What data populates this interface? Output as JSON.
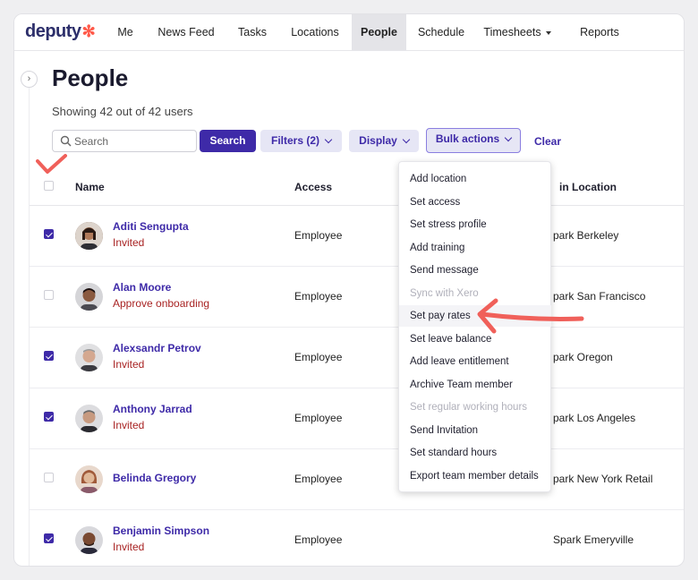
{
  "nav": {
    "logo_text": "deputy",
    "items": [
      {
        "label": "Me"
      },
      {
        "label": "News Feed"
      },
      {
        "label": "Tasks"
      },
      {
        "label": "Locations"
      },
      {
        "label": "People"
      },
      {
        "label": "Schedule"
      },
      {
        "label": "Timesheets"
      },
      {
        "label": "Reports"
      }
    ],
    "active": "People"
  },
  "page": {
    "title": "People",
    "subtitle": "Showing 42 out of 42 users"
  },
  "toolbar": {
    "search_placeholder": "Search",
    "search_button": "Search",
    "filters_label": "Filters (2)",
    "display_label": "Display",
    "bulk_label": "Bulk actions",
    "clear_label": "Clear"
  },
  "table": {
    "headers": {
      "name": "Name",
      "access": "Access",
      "location": "in Location"
    },
    "rows": [
      {
        "name": "Aditi Sengupta",
        "status": "Invited",
        "access": "Employee",
        "location": "park Berkeley",
        "checked": true
      },
      {
        "name": "Alan Moore",
        "status": "Approve onboarding",
        "access": "Employee",
        "location": "park San Francisco",
        "checked": false
      },
      {
        "name": "Alexsandr Petrov",
        "status": "Invited",
        "access": "Employee",
        "location": "park Oregon",
        "checked": true
      },
      {
        "name": "Anthony Jarrad",
        "status": "Invited",
        "access": "Employee",
        "location": "park Los Angeles",
        "checked": true
      },
      {
        "name": "Belinda Gregory",
        "status": "",
        "access": "Employee",
        "location": "park New York Retail",
        "checked": false
      },
      {
        "name": "Benjamin Simpson",
        "status": "Invited",
        "access": "Employee",
        "location": "Spark Emeryville",
        "checked": true
      }
    ]
  },
  "bulk_menu": {
    "items": [
      {
        "label": "Add location",
        "disabled": false
      },
      {
        "label": "Set access",
        "disabled": false
      },
      {
        "label": "Set stress profile",
        "disabled": false
      },
      {
        "label": "Add training",
        "disabled": false
      },
      {
        "label": "Send message",
        "disabled": false
      },
      {
        "label": "Sync with Xero",
        "disabled": true
      },
      {
        "label": "Set pay rates",
        "disabled": false,
        "highlighted": true
      },
      {
        "label": "Set leave balance",
        "disabled": false
      },
      {
        "label": "Add leave entitlement",
        "disabled": false
      },
      {
        "label": "Archive Team member",
        "disabled": false
      },
      {
        "label": "Set regular working hours",
        "disabled": true
      },
      {
        "label": "Send Invitation",
        "disabled": false
      },
      {
        "label": "Set standard hours",
        "disabled": false
      },
      {
        "label": "Export team member details",
        "disabled": false
      }
    ]
  },
  "colors": {
    "brand": "#3e2aa8",
    "status_red": "#a82323",
    "annotation": "#f0605a"
  }
}
